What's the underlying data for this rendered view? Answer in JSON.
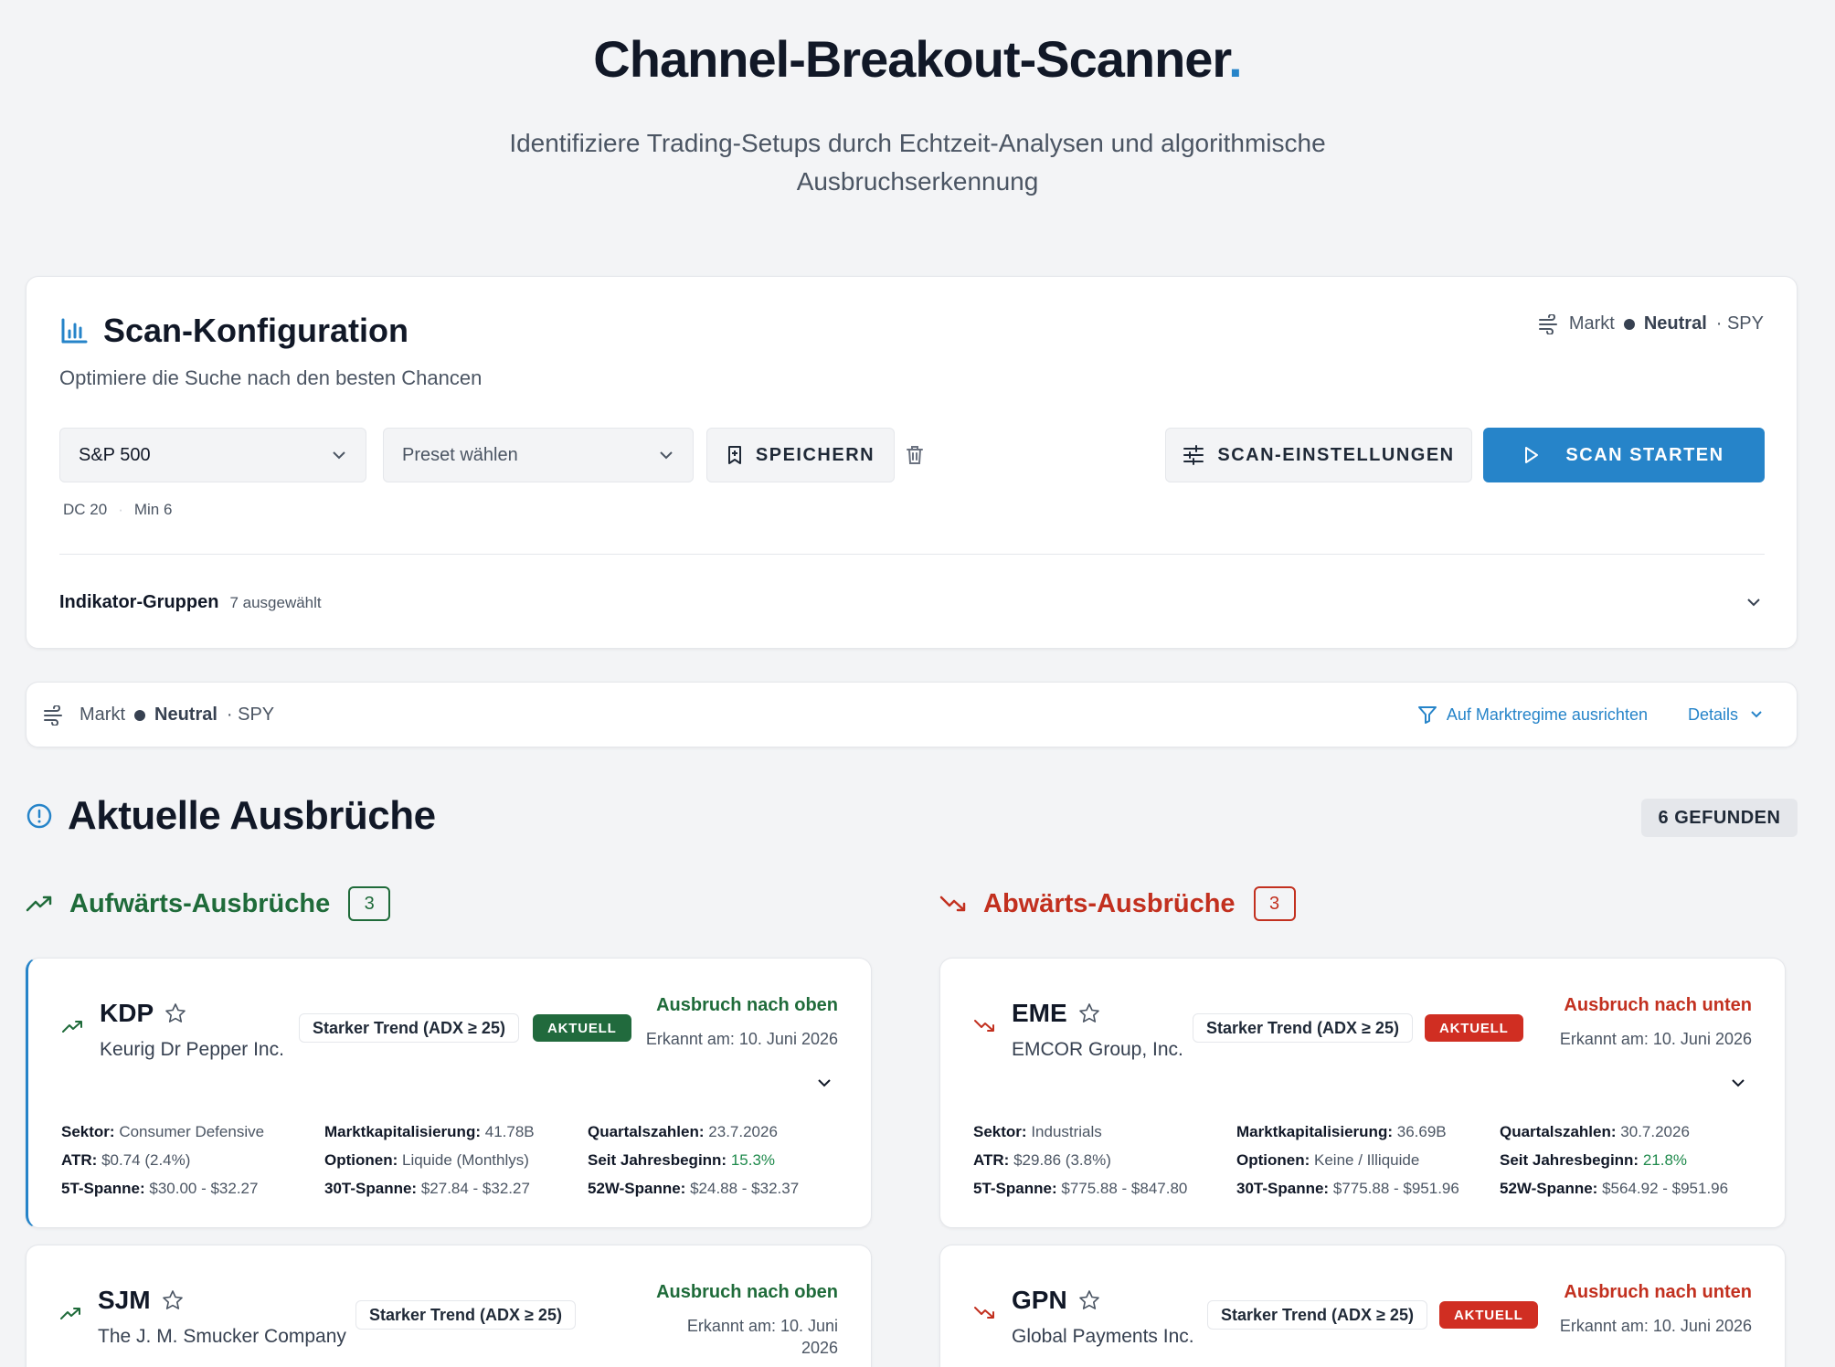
{
  "header": {
    "title": "Channel-Breakout-Scanner",
    "title_dot": ".",
    "subtitle": "Identifiziere Trading-Setups durch Echtzeit-Analysen und algorithmische Ausbruchserkennung"
  },
  "config": {
    "title": "Scan-Konfiguration",
    "subtitle": "Optimiere die Suche nach den besten Chancen",
    "market": {
      "label": "Markt",
      "state": "Neutral",
      "index": "· SPY"
    },
    "universe_select": "S&P 500",
    "preset_placeholder": "Preset wählen",
    "save_label": "SPEICHERN",
    "settings_label": "SCAN-EINSTELLUNGEN",
    "start_label": "SCAN STARTEN",
    "meta": [
      "DC 20",
      "·",
      "Min 6"
    ],
    "groups_label": "Indikator-Gruppen",
    "groups_count": "7 ausgewählt"
  },
  "market_bar": {
    "label": "Markt",
    "state": "Neutral",
    "index": "· SPY",
    "align_label": "Auf Marktregime ausrichten",
    "details_label": "Details"
  },
  "results": {
    "title": "Aktuelle Ausbrüche",
    "found_label": "6 GEFUNDEN",
    "up_title": "Aufwärts-Ausbrüche",
    "up_count": "3",
    "down_title": "Abwärts-Ausbrüche",
    "down_count": "3"
  },
  "stocks": {
    "kdp": {
      "ticker": "KDP",
      "company": "Keurig Dr Pepper Inc.",
      "badge": "Starker Trend (ADX ≥ 25)",
      "status": "AKTUELL",
      "direction": "Ausbruch nach oben",
      "detected": "Erkannt am: 10. Juni 2026",
      "sector_k": "Sektor:",
      "sector": "Consumer Defensive",
      "mcap_k": "Marktkapitalisierung:",
      "mcap": "41.78B",
      "earn_k": "Quartalszahlen:",
      "earn": "23.7.2026",
      "atr_k": "ATR:",
      "atr": "$0.74 (2.4%)",
      "opt_k": "Optionen:",
      "opt": "Liquide (Monthlys)",
      "ytd_k": "Seit Jahresbeginn:",
      "ytd": "15.3%",
      "r5_k": "5T-Spanne:",
      "r5": "$30.00 - $32.27",
      "r30_k": "30T-Spanne:",
      "r30": "$27.84 - $32.27",
      "r52_k": "52W-Spanne:",
      "r52": "$24.88 - $32.37"
    },
    "eme": {
      "ticker": "EME",
      "company": "EMCOR Group, Inc.",
      "badge": "Starker Trend (ADX ≥ 25)",
      "status": "AKTUELL",
      "direction": "Ausbruch nach unten",
      "detected": "Erkannt am: 10. Juni 2026",
      "sector_k": "Sektor:",
      "sector": "Industrials",
      "mcap_k": "Marktkapitalisierung:",
      "mcap": "36.69B",
      "earn_k": "Quartalszahlen:",
      "earn": "30.7.2026",
      "atr_k": "ATR:",
      "atr": "$29.86 (3.8%)",
      "opt_k": "Optionen:",
      "opt": "Keine / Illiquide",
      "ytd_k": "Seit Jahresbeginn:",
      "ytd": "21.8%",
      "r5_k": "5T-Spanne:",
      "r5": "$775.88 - $847.80",
      "r30_k": "30T-Spanne:",
      "r30": "$775.88 - $951.96",
      "r52_k": "52W-Spanne:",
      "r52": "$564.92 - $951.96"
    },
    "sjm": {
      "ticker": "SJM",
      "company": "The J. M. Smucker Company",
      "badge": "Starker Trend (ADX ≥ 25)",
      "direction": "Ausbruch nach oben",
      "detected_1": "Erkannt am: 10. Juni",
      "detected_2": "2026"
    },
    "gpn": {
      "ticker": "GPN",
      "company": "Global Payments Inc.",
      "badge": "Starker Trend (ADX ≥ 25)",
      "status": "AKTUELL",
      "direction": "Ausbruch nach unten",
      "detected": "Erkannt am: 10. Juni 2026"
    }
  }
}
